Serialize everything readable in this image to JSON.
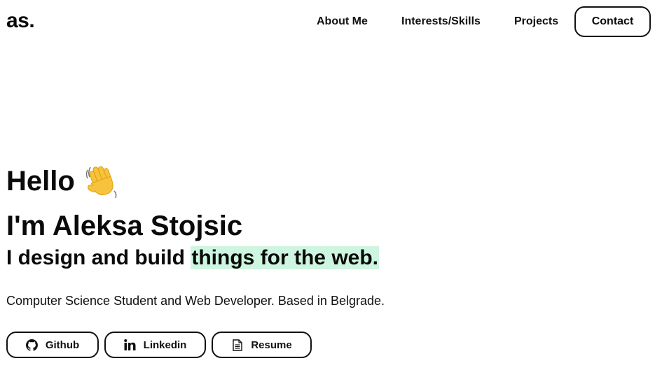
{
  "header": {
    "logo": "as.",
    "nav": {
      "about": "About Me",
      "skills": "Interests/Skills",
      "projects": "Projects",
      "contact": "Contact"
    }
  },
  "hero": {
    "greeting": "Hello",
    "greeting_icon": "waving-hand-emoji",
    "name_line": "I'm Aleksa Stojsic",
    "tagline_prefix": "I design and build ",
    "tagline_highlight": "things for the web.",
    "description": "Computer Science Student and Web Developer. Based in Belgrade."
  },
  "links": [
    {
      "label": "Github",
      "icon": "github-icon"
    },
    {
      "label": "Linkedin",
      "icon": "linkedin-icon"
    },
    {
      "label": "Resume",
      "icon": "document-icon"
    }
  ],
  "colors": {
    "text": "#0a0a0a",
    "highlight": "#cdf5e0",
    "background": "#ffffff"
  }
}
